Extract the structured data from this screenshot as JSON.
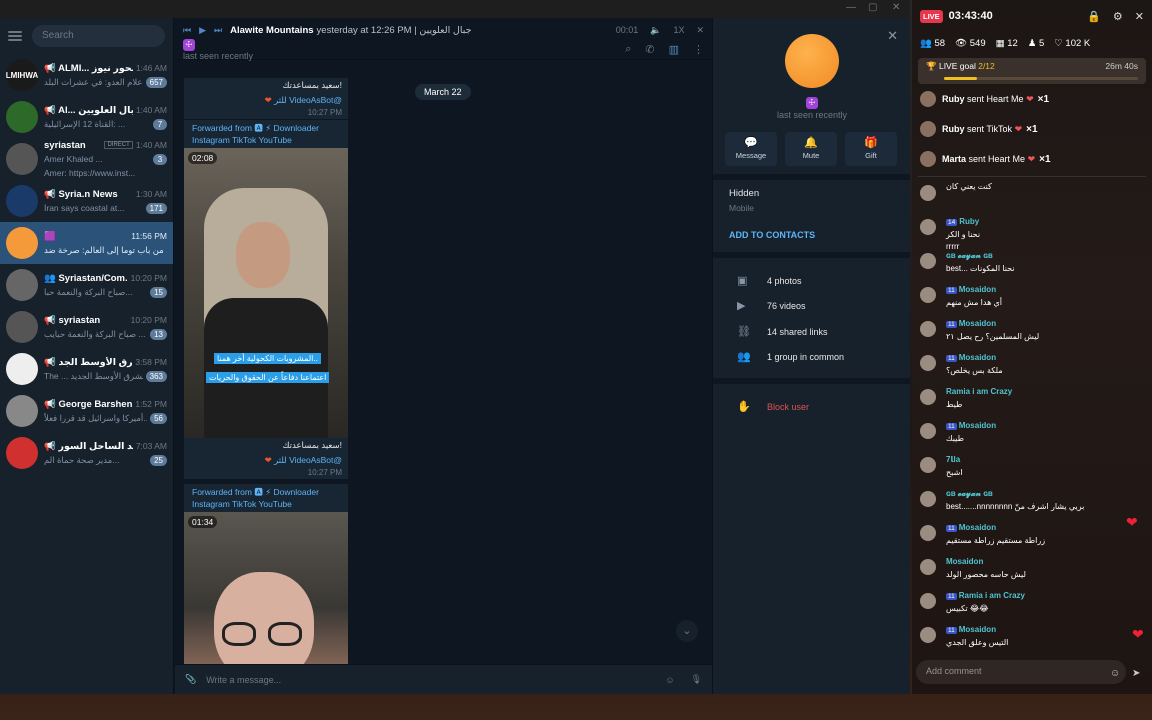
{
  "colors": {
    "accent": "#5288c1",
    "badge": "#5e7c9a",
    "live": "#e8364c",
    "selected": "#2b5278"
  },
  "search": {
    "placeholder": "Search"
  },
  "chats": [
    {
      "name": "📢 ALMI... المحور نيوز - ",
      "time": "1:46 AM",
      "msg": "إعلام العدو: في عشرات البلد...",
      "badge": "657",
      "av": "#1a1a1a",
      "avtxt": "ALMIHWAR"
    },
    {
      "name": "📢 Al... جبال العلويين",
      "time": "1:40 AM",
      "msg": "القناة 12 الإسرائيلية: ...",
      "badge": "7",
      "av": "#2d6a2a",
      "avtxt": ""
    },
    {
      "name": "syriastan",
      "tag": "DIRECT",
      "time": "1:40 AM",
      "msg": "Amer  Khaled ...",
      "msg2": "Amer: https://www.inst...",
      "badge": "3",
      "av": "#555",
      "avtxt": ""
    },
    {
      "name": "📢 Syria.n News",
      "time": "1:30 AM",
      "msg": "İran says coastal at...",
      "badge": "171",
      "av": "#1a3a6a",
      "avtxt": ""
    },
    {
      "name": "🟪",
      "time": "11:56 PM",
      "msg": "من باب توما إلى العالم: صرخة ضد ...",
      "badge": "",
      "av": "#f59a3a",
      "avtxt": "",
      "sel": true
    },
    {
      "name": "👥 Syriastan/Com...",
      "time": "10:20 PM",
      "msg": "صباح البركة والنعمة حبا...",
      "badge": "15",
      "av": "#666",
      "avtxt": ""
    },
    {
      "name": "📢 syriastan",
      "time": "10:20 PM",
      "msg": "صباح البركة والنعمة حبايب ...",
      "badge": "13",
      "av": "#555",
      "avtxt": ""
    },
    {
      "name": "📢 الشرق الأوسط الجد...",
      "time": "3:58 PM",
      "msg": "The ... الشرق الأوسط الجديد",
      "badge": "363",
      "av": "#eee",
      "avtxt": ""
    },
    {
      "name": "📢 George Barshen ...",
      "time": "1:52 PM",
      "msg": "أميركا واسرائيل قد قررا فعلاً...",
      "badge": "56",
      "av": "#888",
      "avtxt": ""
    },
    {
      "name": "📢 مرصد الساحل السور...",
      "time": "7:03 AM",
      "msg": "مدير صحة حماة الم...",
      "badge": "25",
      "av": "#d03030",
      "avtxt": ""
    }
  ],
  "header": {
    "title": "Alawite Mountains",
    "sub": "yesterday at 12:26 PM | جبال العلويين",
    "time": "00:01",
    "speed": "1X",
    "lastseen": "last seen recently"
  },
  "feed": {
    "date": "March 22",
    "cap1a": "سعيد بمساعدتك!",
    "cap1b": "للثر VideoAsBot@",
    "t1": "10:27 PM",
    "fwd": "Forwarded from 🅰 ⚡ Downloader",
    "fwd2": "Instagram TikTok YouTube",
    "dur1": "02:08",
    "ov1": "المشروبات الكحولية أخر همنا..",
    "ov2": "اعتماعنا دفاعاً عن الحقوق والحريات",
    "cap2a": "سعيد بمساعدتك!",
    "cap2b": "للثر VideoAsBot@",
    "t2": "10:27 PM",
    "dur2": "01:34"
  },
  "compose": {
    "placeholder": "Write a message..."
  },
  "info": {
    "lastseen": "last seen recently",
    "actions": [
      "Message",
      "Mute",
      "Gift"
    ],
    "bio": "Hidden",
    "biosub": "Mobile",
    "add": "ADD TO CONTACTS",
    "media": [
      "4 photos",
      "76 videos",
      "14 shared links",
      "1 group in common"
    ],
    "block": "Block user"
  },
  "live": {
    "badge": "LIVE",
    "time": "03:43:40",
    "stats": [
      "58",
      "549",
      "12",
      "5",
      "102 K"
    ],
    "goal": "LIVE goal",
    "goalval": "2/12",
    "goaltime": "26m 40s",
    "goal_progress": 0.17,
    "gifts": [
      {
        "u": "Ruby",
        "t": "sent Heart Me",
        "x": "×1"
      },
      {
        "u": "Ruby",
        "t": "sent TikTok",
        "x": "×1"
      },
      {
        "u": "Marta",
        "t": "sent Heart Me",
        "x": "×1"
      }
    ],
    "comments": [
      {
        "u": "",
        "lv": "",
        "t": "كنت يعني كان"
      },
      {
        "u": "Ruby",
        "lv": "14",
        "t": "نحنا و الكر",
        "t2": "rrrrr"
      },
      {
        "u": "ɢʙ 𝓮𝓪𝔂𝓪𝓷 ɢʙ",
        "lv": "",
        "t": "best... نحنا المكونات"
      },
      {
        "u": "Mosaidon",
        "lv": "11",
        "t": "أي هدا مش منهم"
      },
      {
        "u": "Mosaidon",
        "lv": "11",
        "t": "ليش المسلمين؟ رح يصل ٢١"
      },
      {
        "u": "Mosaidon",
        "lv": "11",
        "t": "ملكة بس يخلص؟"
      },
      {
        "u": "Ramia i am Crazy",
        "lv": "",
        "t": "طيط"
      },
      {
        "u": "Mosaidon",
        "lv": "11",
        "t": "طيبك"
      },
      {
        "u": "7ﺎla",
        "lv": "",
        "t": "اشبح"
      },
      {
        "u": "ɢʙ 𝓮𝓪𝔂𝓪𝓷 ɢʙ",
        "lv": "",
        "t": "best.......nnnnnnnn بريي يشار اشرف منّ"
      },
      {
        "u": "Mosaidon",
        "lv": "11",
        "t": "زراطة مستقيم زراطة مستقيم"
      },
      {
        "u": "Mosaidon",
        "lv": "",
        "t": "ليش حاسه محصور الولد"
      },
      {
        "u": "Ramia i am Crazy",
        "lv": "11",
        "t": "تكبيس 😂😂"
      },
      {
        "u": "Mosaidon",
        "lv": "11",
        "t": "التيس وعلق الجدي"
      }
    ],
    "addcomment": "Add comment"
  }
}
